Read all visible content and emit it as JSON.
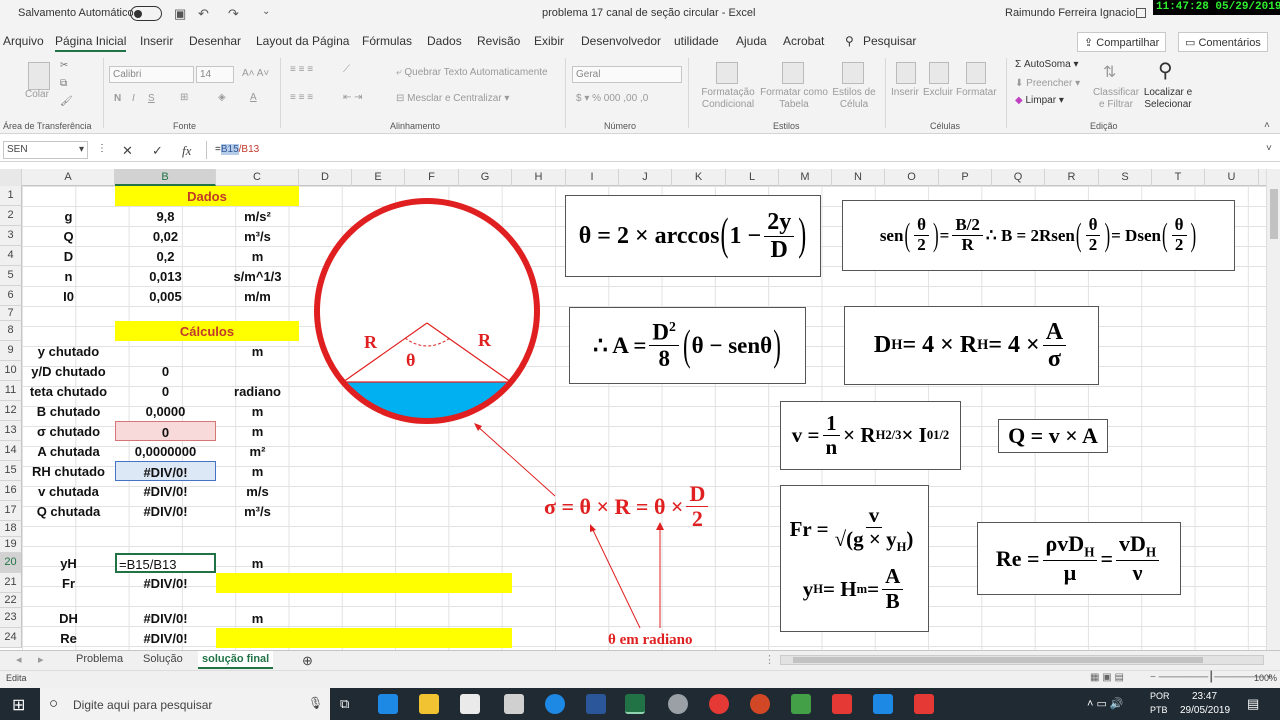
{
  "titlebar": {
    "autosave": "Salvamento Automático",
    "title": "problema 17 canal de seção circular  -  Excel",
    "user": "Raimundo Ferreira Ignacio",
    "clock": "11:47:28  05/29/2019"
  },
  "menu": {
    "tabs": [
      "Arquivo",
      "Página Inicial",
      "Inserir",
      "Desenhar",
      "Layout da Página",
      "Fórmulas",
      "Dados",
      "Revisão",
      "Exibir",
      "Desenvolvedor",
      "utilidade",
      "Ajuda",
      "Acrobat",
      "Pesquisar"
    ],
    "active": "Página Inicial",
    "share": "Compartilhar",
    "comments": "Comentários"
  },
  "ribbon": {
    "paste": "Colar",
    "clipboard": "Área de Transferência",
    "font_name": "Calibri",
    "font_size": "14",
    "font_group": "Fonte",
    "wrap": "Quebrar Texto Automaticamente",
    "merge": "Mesclar e Centralizar",
    "align_group": "Alinhamento",
    "number_format": "Geral",
    "number_group": "Número",
    "cond_format": "Formatação Condicional",
    "format_table": "Formatar como Tabela",
    "cell_styles": "Estilos de Célula",
    "styles_group": "Estilos",
    "insert": "Inserir",
    "delete": "Excluir",
    "format": "Formatar",
    "cells_group": "Células",
    "autosum": "AutoSoma",
    "fill": "Preencher",
    "clear": "Limpar",
    "sort_filter": "Classificar e Filtrar",
    "find_select": "Localizar e Selecionar",
    "edit_group": "Edição"
  },
  "formula_bar": {
    "name_box": "SEN",
    "formula_ref1": "B15",
    "formula_rest": "/B13"
  },
  "columns": [
    "A",
    "B",
    "C",
    "D",
    "E",
    "F",
    "G",
    "H",
    "I",
    "J",
    "K",
    "L",
    "M",
    "N",
    "O",
    "P",
    "Q",
    "R",
    "S",
    "T",
    "U"
  ],
  "rows": [
    "1",
    "2",
    "3",
    "4",
    "5",
    "6",
    "7",
    "8",
    "9",
    "10",
    "11",
    "12",
    "13",
    "14",
    "15",
    "16",
    "17",
    "18",
    "19",
    "20",
    "21",
    "22",
    "23",
    "24"
  ],
  "cells": {
    "dados": "Dados",
    "calculos": "Cálculos",
    "g": {
      "a": "g",
      "b": "9,8",
      "c": "m/s²"
    },
    "Q": {
      "a": "Q",
      "b": "0,02",
      "c": "m³/s"
    },
    "D": {
      "a": "D",
      "b": "0,2",
      "c": "m"
    },
    "n": {
      "a": "n",
      "b": "0,013",
      "c": "s/m^1/3"
    },
    "I0": {
      "a": "I0",
      "b": "0,005",
      "c": "m/m"
    },
    "r9": {
      "a": "y chutado",
      "b": "",
      "c": "m"
    },
    "r10": {
      "a": "y/D chutado",
      "b": "0",
      "c": ""
    },
    "r11": {
      "a": "teta chutado",
      "b": "0",
      "c": "radiano"
    },
    "r12": {
      "a": "B chutado",
      "b": "0,0000",
      "c": "m"
    },
    "r13": {
      "a": "σ chutado",
      "b": "0",
      "c": "m"
    },
    "r14": {
      "a": "A chutada",
      "b": "0,0000000",
      "c": "m²"
    },
    "r15": {
      "a": "RH chutado",
      "b": "#DIV/0!",
      "c": "m"
    },
    "r16": {
      "a": "v chutada",
      "b": "#DIV/0!",
      "c": "m/s"
    },
    "r17": {
      "a": "Q chutada",
      "b": "#DIV/0!",
      "c": "m³/s"
    },
    "r20": {
      "a": "yH",
      "b": "=B15/B13",
      "c": "m"
    },
    "r21": {
      "a": "Fr",
      "b": "#DIV/0!",
      "c": ""
    },
    "r23": {
      "a": "DH",
      "b": "#DIV/0!",
      "c": "m"
    },
    "r24": {
      "a": "Re",
      "b": "#DIV/0!",
      "c": ""
    }
  },
  "diagram": {
    "R_left": "R",
    "R_right": "R",
    "theta": "θ",
    "sigma_eq_label": "σ = θ × R = θ × D/2",
    "theta_note": "θ em radiano",
    "water_color": "#00b0f0",
    "circle_color": "#e02020"
  },
  "sheets": {
    "tabs": [
      "Problema",
      "Solução",
      "solução final"
    ],
    "active": "solução final"
  },
  "status": {
    "mode": "Edita",
    "zoom": "100%"
  },
  "taskbar": {
    "search": "Digite aqui para pesquisar",
    "lang1": "POR",
    "lang2": "PTB",
    "time": "23:47",
    "date": "29/05/2019"
  }
}
